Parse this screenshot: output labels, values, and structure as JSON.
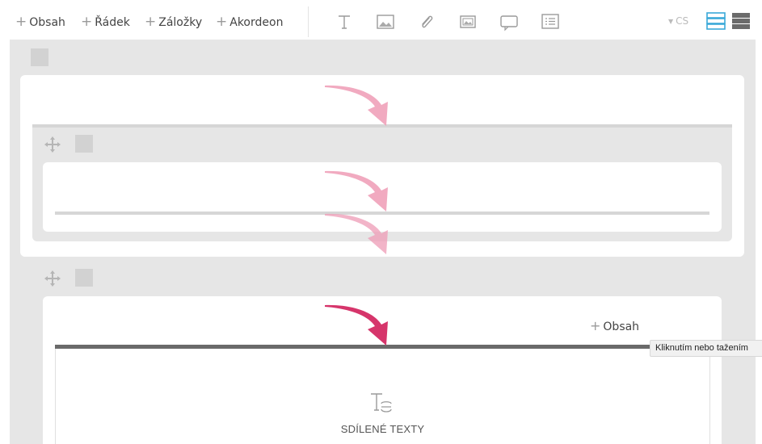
{
  "toolbar": {
    "add_items": [
      {
        "label": "Obsah"
      },
      {
        "label": "Řádek"
      },
      {
        "label": "Záložky"
      },
      {
        "label": "Akordeon"
      }
    ],
    "plus_glyph": "+",
    "widget_icons": [
      "text-icon",
      "image-icon",
      "attachment-icon",
      "gallery-icon",
      "comment-icon",
      "list-icon"
    ],
    "language": "CS",
    "view_icons": [
      "rows-view-icon",
      "blocks-view-icon"
    ]
  },
  "rows": {
    "inner_add_content_label": "Obsah"
  },
  "tooltip": {
    "text": "Kliknutím nebo tažením"
  },
  "shared_texts": {
    "label": "SDÍLENÉ TEXTY"
  },
  "colors": {
    "accent": "#3aa8d8",
    "arrow_active": "#d6356b",
    "arrow_faded": "#ee9bb5",
    "canvas_gray": "#e6e6e6",
    "drop_line_dark": "#6a6a6a"
  }
}
